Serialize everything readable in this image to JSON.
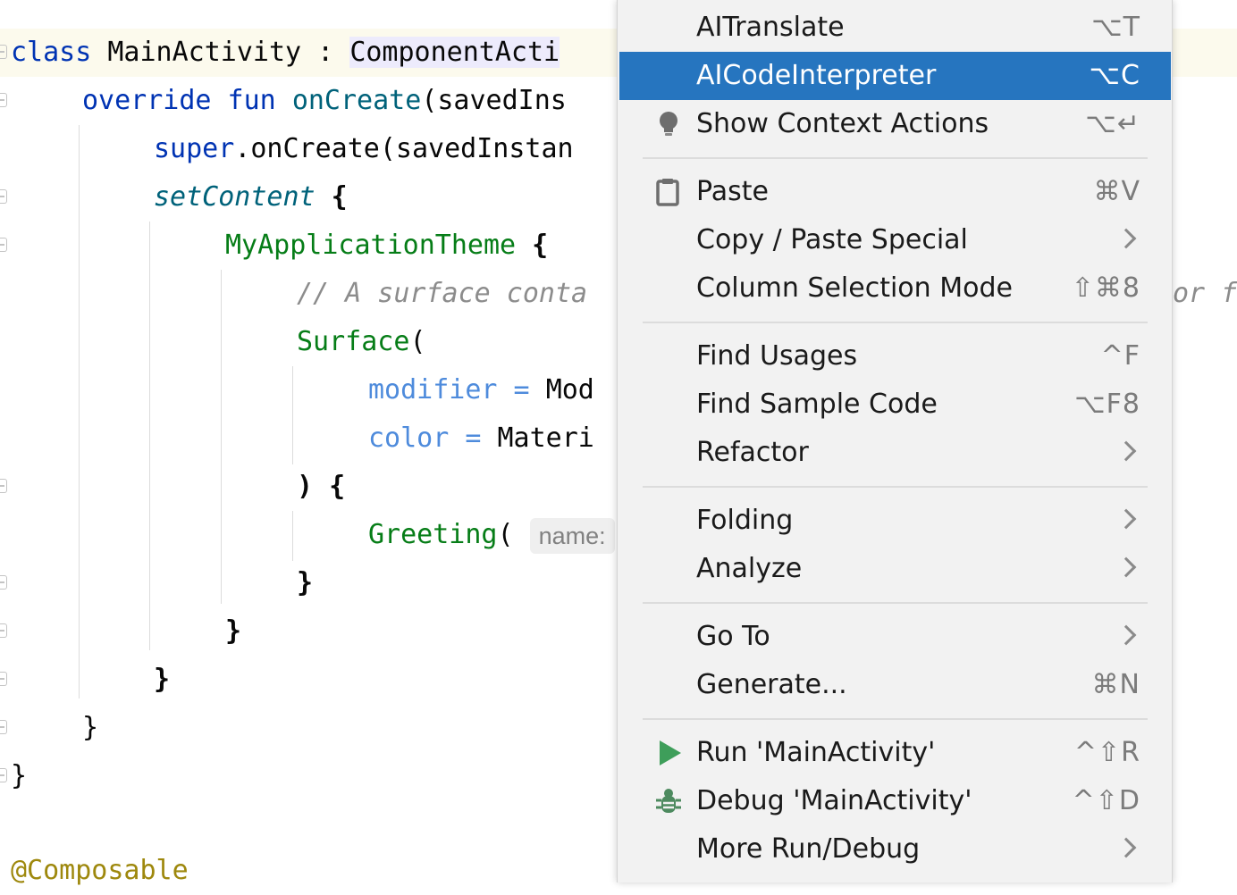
{
  "editor": {
    "lines": [
      {
        "parts": [
          "class",
          ": ",
          "MainActivity : ",
          "ComponentActi"
        ]
      },
      {
        "parts": [
          "override fun ",
          "onCreate",
          "(savedIns"
        ]
      },
      {
        "parts": [
          "super",
          ".onCreate(savedInstan"
        ]
      },
      {
        "parts": [
          "setContent",
          " {"
        ]
      },
      {
        "parts": [
          "MyApplicationTheme",
          " {"
        ]
      },
      {
        "parts": [
          "// A surface conta"
        ]
      },
      {
        "parts": [
          "Surface",
          "("
        ]
      },
      {
        "parts": [
          "modifier",
          " = ",
          "Mod"
        ]
      },
      {
        "parts": [
          "color",
          " = ",
          "Materi"
        ]
      },
      {
        "parts": [
          ") {"
        ]
      },
      {
        "parts": [
          "Greeting",
          "( ",
          "name:"
        ]
      },
      {
        "parts": [
          "}"
        ]
      },
      {
        "parts": [
          "}"
        ]
      },
      {
        "parts": [
          "}"
        ]
      },
      {
        "parts": [
          "}"
        ]
      },
      {
        "parts": [
          "}"
        ]
      },
      {
        "parts": [
          "@Composable"
        ]
      }
    ],
    "overflow_text": "or f"
  },
  "menu": {
    "items": [
      {
        "label": "AITranslate",
        "shortcut": "⌥T"
      },
      {
        "label": "AICodeInterpreter",
        "shortcut": "⌥C",
        "selected": true
      },
      {
        "label": "Show Context Actions",
        "shortcut": "⌥↵",
        "icon": "bulb-icon"
      },
      {
        "label": "Paste",
        "shortcut": "⌘V",
        "icon": "clipboard-icon"
      },
      {
        "label": "Copy / Paste Special",
        "submenu": true
      },
      {
        "label": "Column Selection Mode",
        "shortcut": "⇧⌘8"
      },
      {
        "label": "Find Usages",
        "shortcut": "^F"
      },
      {
        "label": "Find Sample Code",
        "shortcut": "⌥F8"
      },
      {
        "label": "Refactor",
        "submenu": true
      },
      {
        "label": "Folding",
        "submenu": true
      },
      {
        "label": "Analyze",
        "submenu": true
      },
      {
        "label": "Go To",
        "submenu": true
      },
      {
        "label": "Generate...",
        "shortcut": "⌘N"
      },
      {
        "label": "Run 'MainActivity'",
        "shortcut": "^⇧R",
        "icon": "run-icon"
      },
      {
        "label": "Debug 'MainActivity'",
        "shortcut": "^⇧D",
        "icon": "debug-icon"
      },
      {
        "label": "More Run/Debug",
        "submenu": true
      }
    ]
  },
  "colors": {
    "selection": "#2675bf",
    "keyword": "#0033b3",
    "composable": "#067d17",
    "comment": "#8c8c8c",
    "param": "#4e8bdc",
    "annotation": "#9e880d"
  }
}
